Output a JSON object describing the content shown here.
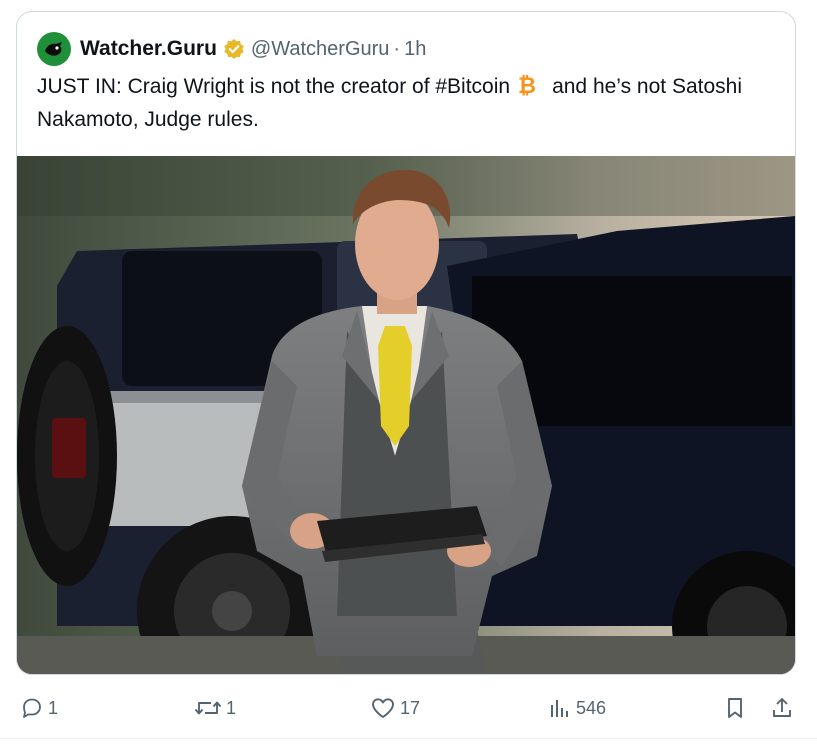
{
  "tweet": {
    "author_name": "Watcher.Guru",
    "handle": "@WatcherGuru",
    "separator": "·",
    "time": "1h",
    "text_part1": "JUST IN: Craig Wright is not the creator of #Bitcoin",
    "text_part2": "and he’s not Satoshi Nakamoto, Judge rules."
  },
  "actions": {
    "replies": "1",
    "reposts": "1",
    "likes": "17",
    "views": "546"
  },
  "icons": [
    "avatar-logo-icon",
    "verified-badge-icon",
    "bitcoin-icon",
    "reply-icon",
    "repost-icon",
    "like-icon",
    "views-icon",
    "bookmark-icon",
    "share-icon"
  ],
  "colors": {
    "verified": "#e8b829",
    "bitcoin": "#f7931a",
    "muted": "#536471",
    "border": "#cfd9de",
    "avatar_bg": "#1f8f3a"
  }
}
